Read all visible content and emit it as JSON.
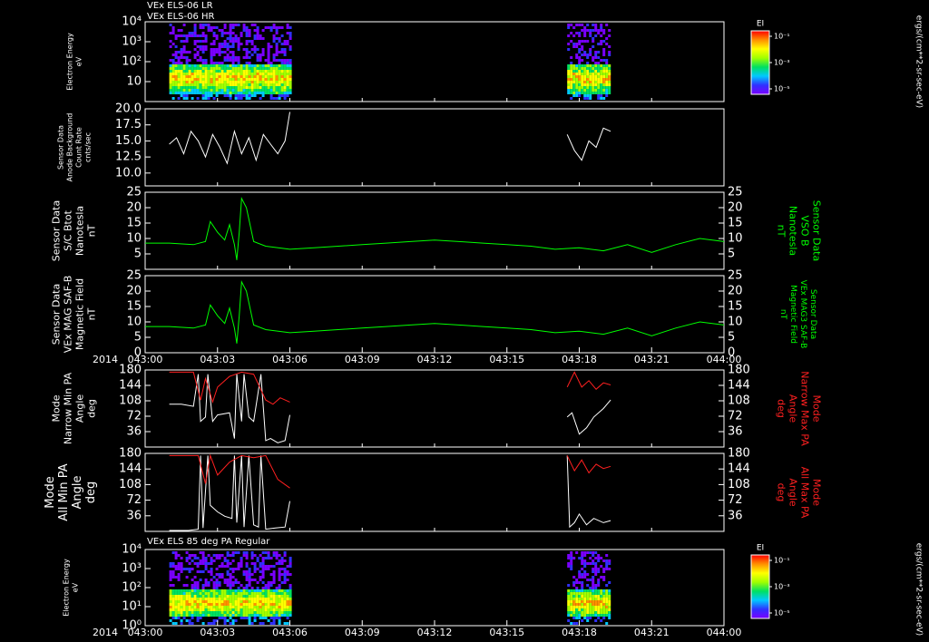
{
  "header": {
    "lines": [
      "VEx ELS-06 LR",
      "VEx ELS-06 HR"
    ]
  },
  "footer_label": "VEx ELS 85 deg PA Regular",
  "year_label": "2014",
  "colorbars": [
    {
      "title": "EI",
      "tick_labels": [
        "10⁻¹",
        "10⁻³",
        "10⁻⁵"
      ],
      "unit_label": "ergs/(cm**2-sr-sec-eV)",
      "scale": "log",
      "colors": [
        "#7a00ff",
        "#3030ff",
        "#00c8ff",
        "#00e060",
        "#a0ff00",
        "#ffff00",
        "#ff9000",
        "#ff0000"
      ]
    },
    {
      "title": "EI",
      "tick_labels": [
        "10⁻¹",
        "10⁻³",
        "10⁻⁵"
      ],
      "unit_label": "ergs/(cm**2-sr-sec-eV)",
      "scale": "log",
      "colors": [
        "#7a00ff",
        "#3030ff",
        "#00c8ff",
        "#00e060",
        "#a0ff00",
        "#ffff00",
        "#ff9000",
        "#ff0000"
      ]
    }
  ],
  "x_axis": {
    "tick_labels": [
      "043:00",
      "043:03",
      "043:06",
      "043:09",
      "043:12",
      "043:15",
      "043:18",
      "043:21",
      "044:00"
    ],
    "range_minutes": [
      0,
      24
    ]
  },
  "chart_data": [
    {
      "type": "heatmap",
      "ylabel_lines": [
        "Electron Energy",
        "eV"
      ],
      "y_tick_labels": [
        "10⁴",
        "10³",
        "10²",
        "10"
      ],
      "yscale": "log",
      "ylim": [
        1,
        10000
      ],
      "x_data_intervals": [
        [
          1.0,
          6.0
        ],
        [
          17.5,
          19.3
        ]
      ],
      "peak_energy_band_ev": [
        3,
        100
      ]
    },
    {
      "type": "line",
      "ylabel_lines": [
        "Sensor Data",
        "Anode Background",
        "Count Rate",
        "cnts/sec"
      ],
      "y_tick_labels": [
        "20.0",
        "17.5",
        "15.0",
        "12.5",
        "10.0"
      ],
      "ylim": [
        8,
        20
      ],
      "series": [
        {
          "color": "#ffffff",
          "segments": [
            {
              "x": [
                1.0,
                1.3,
                1.6,
                1.9,
                2.2,
                2.5,
                2.8,
                3.1,
                3.4,
                3.7,
                4.0,
                4.3,
                4.6,
                4.9,
                5.2,
                5.5,
                5.8,
                6.0
              ],
              "y": [
                14.5,
                15.5,
                13.0,
                16.5,
                15.0,
                12.5,
                16.0,
                14.0,
                11.5,
                16.5,
                13.0,
                15.5,
                12.0,
                16.0,
                14.5,
                13.0,
                15.0,
                19.5
              ]
            },
            {
              "x": [
                17.5,
                17.8,
                18.1,
                18.4,
                18.7,
                19.0,
                19.3
              ],
              "y": [
                16.0,
                13.5,
                12.0,
                15.0,
                14.0,
                17.0,
                16.5
              ]
            }
          ]
        }
      ]
    },
    {
      "type": "line",
      "ylabel_lines": [
        "Sensor Data",
        "S/C Btot",
        "Nanotesla",
        "nT"
      ],
      "right_label_lines": [
        "Sensor Data",
        "VSO B",
        "Nanotesla",
        "nT"
      ],
      "right_label_color": "#00ff00",
      "y_tick_labels": [
        "25",
        "20",
        "15",
        "10",
        "5"
      ],
      "ylim": [
        0,
        25
      ],
      "series": [
        {
          "color": "#00ff00",
          "x": [
            0,
            1,
            2,
            2.5,
            2.7,
            3.0,
            3.3,
            3.5,
            3.7,
            3.8,
            3.9,
            4.0,
            4.2,
            4.5,
            5,
            6,
            7,
            8,
            9,
            10,
            11,
            12,
            13,
            14,
            15,
            16,
            17,
            18,
            19,
            20,
            21,
            22,
            23,
            24
          ],
          "y": [
            8.5,
            8.5,
            8.0,
            9.0,
            15.5,
            12.0,
            9.5,
            14.5,
            8.0,
            3.0,
            12.0,
            23.0,
            20.0,
            9.0,
            7.5,
            6.5,
            7.0,
            7.5,
            8.0,
            8.5,
            9.0,
            9.5,
            9.0,
            8.5,
            8.0,
            7.5,
            6.5,
            7.0,
            6.0,
            8.0,
            5.5,
            8.0,
            10.0,
            9.0
          ]
        }
      ]
    },
    {
      "type": "line",
      "ylabel_lines": [
        "Sensor Data",
        "VEx MAG SAF-B",
        "Magnetic Field",
        "nT"
      ],
      "right_label_lines": [
        "Sensor Data",
        "VEx MAG3 SAF-B",
        "Magnetic Field",
        "nT"
      ],
      "right_label_color": "#00ff00",
      "y_tick_labels": [
        "25",
        "20",
        "15",
        "10",
        "5",
        "0"
      ],
      "ylim": [
        0,
        25
      ],
      "series": [
        {
          "color": "#00ff00",
          "x": [
            0,
            1,
            2,
            2.5,
            2.7,
            3.0,
            3.3,
            3.5,
            3.7,
            3.8,
            3.9,
            4.0,
            4.2,
            4.5,
            5,
            6,
            7,
            8,
            9,
            10,
            11,
            12,
            13,
            14,
            15,
            16,
            17,
            18,
            19,
            20,
            21,
            22,
            23,
            24
          ],
          "y": [
            8.5,
            8.5,
            8.0,
            9.0,
            15.5,
            12.0,
            9.5,
            14.5,
            8.0,
            3.0,
            12.0,
            23.0,
            20.0,
            9.0,
            7.5,
            6.5,
            7.0,
            7.5,
            8.0,
            8.5,
            9.0,
            9.5,
            9.0,
            8.5,
            8.0,
            7.5,
            6.5,
            7.0,
            6.0,
            8.0,
            5.5,
            8.0,
            10.0,
            9.0
          ]
        }
      ]
    },
    {
      "type": "line",
      "ylabel_lines": [
        "Mode",
        "Narrow Min PA",
        "Angle",
        "deg"
      ],
      "right_label_lines": [
        "Mode",
        "Narrow Max PA",
        "Angle",
        "deg"
      ],
      "right_label_color": "#ff2020",
      "y_tick_labels": [
        "180",
        "144",
        "108",
        "72",
        "36"
      ],
      "ylim": [
        0,
        180
      ],
      "series": [
        {
          "color": "#ffffff",
          "segments": [
            {
              "x": [
                1.0,
                1.5,
                2.0,
                2.2,
                2.3,
                2.5,
                2.6,
                2.8,
                3.0,
                3.5,
                3.7,
                3.8,
                4.0,
                4.1,
                4.3,
                4.5,
                4.8,
                5.0,
                5.2,
                5.5,
                5.8,
                6.0
              ],
              "y": [
                100,
                100,
                95,
                170,
                60,
                70,
                170,
                60,
                75,
                80,
                20,
                170,
                60,
                170,
                70,
                60,
                170,
                15,
                20,
                10,
                15,
                75
              ]
            },
            {
              "x": [
                17.5,
                17.7,
                18.0,
                18.3,
                18.6,
                19.0,
                19.3
              ],
              "y": [
                70,
                80,
                30,
                45,
                70,
                90,
                110
              ]
            }
          ]
        },
        {
          "color": "#ff2020",
          "segments": [
            {
              "x": [
                1.0,
                1.5,
                2.0,
                2.3,
                2.5,
                2.8,
                3.0,
                3.5,
                4.0,
                4.5,
                5.0,
                5.3,
                5.6,
                6.0
              ],
              "y": [
                175,
                175,
                175,
                110,
                160,
                105,
                140,
                165,
                175,
                170,
                110,
                100,
                115,
                105
              ]
            },
            {
              "x": [
                17.5,
                17.8,
                18.1,
                18.4,
                18.7,
                19.0,
                19.3
              ],
              "y": [
                140,
                175,
                140,
                155,
                135,
                150,
                145
              ]
            }
          ]
        }
      ]
    },
    {
      "type": "line",
      "ylabel_lines": [
        "Mode",
        "All Min PA",
        "Angle",
        "deg"
      ],
      "right_label_lines": [
        "Mode",
        "All Max PA",
        "Angle",
        "deg"
      ],
      "right_label_color": "#ff2020",
      "y_tick_labels": [
        "180",
        "144",
        "108",
        "72",
        "36"
      ],
      "ylim": [
        0,
        180
      ],
      "series": [
        {
          "color": "#ffffff",
          "segments": [
            {
              "x": [
                1.0,
                1.8,
                2.2,
                2.3,
                2.4,
                2.6,
                2.7,
                3.0,
                3.3,
                3.6,
                3.7,
                3.8,
                4.0,
                4.1,
                4.3,
                4.5,
                4.7,
                4.8,
                5.0,
                5.4,
                5.8,
                6.0
              ],
              "y": [
                2,
                2,
                5,
                175,
                8,
                175,
                60,
                45,
                35,
                30,
                175,
                20,
                175,
                10,
                175,
                15,
                10,
                175,
                5,
                8,
                10,
                70
              ]
            },
            {
              "x": [
                17.5,
                17.6,
                17.8,
                18.0,
                18.3,
                18.6,
                19.0,
                19.3
              ],
              "y": [
                175,
                10,
                20,
                40,
                15,
                30,
                20,
                25
              ]
            }
          ]
        },
        {
          "color": "#ff2020",
          "segments": [
            {
              "x": [
                1.0,
                1.8,
                2.2,
                2.5,
                2.7,
                3.0,
                3.5,
                4.0,
                4.5,
                5.0,
                5.5,
                6.0
              ],
              "y": [
                175,
                175,
                175,
                110,
                175,
                130,
                160,
                175,
                170,
                175,
                120,
                100
              ]
            },
            {
              "x": [
                17.5,
                17.8,
                18.1,
                18.4,
                18.7,
                19.0,
                19.3
              ],
              "y": [
                175,
                140,
                165,
                135,
                155,
                145,
                150
              ]
            }
          ]
        }
      ]
    },
    {
      "type": "heatmap",
      "ylabel_lines": [
        "Electron Energy",
        "eV"
      ],
      "y_tick_labels": [
        "10⁴",
        "10³",
        "10²",
        "10¹",
        "10⁰"
      ],
      "yscale": "log",
      "ylim": [
        1,
        10000
      ],
      "x_data_intervals": [
        [
          1.0,
          6.0
        ],
        [
          17.5,
          19.3
        ]
      ],
      "peak_energy_band_ev": [
        3,
        100
      ]
    }
  ]
}
